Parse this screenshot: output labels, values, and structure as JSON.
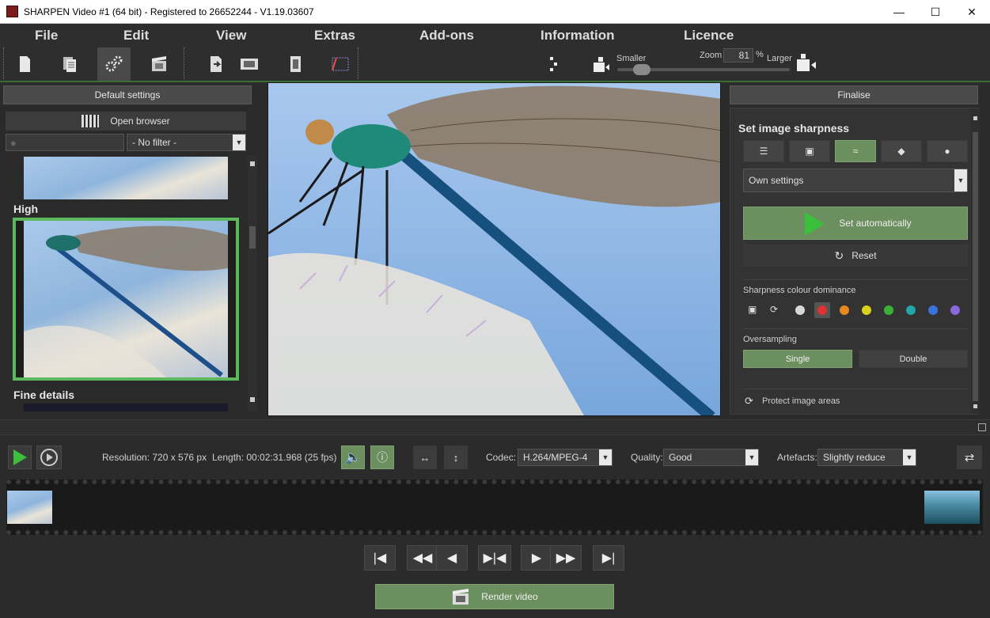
{
  "window": {
    "title": "SHARPEN Video #1 (64 bit) - Registered to 26652244 - V1.19.03607",
    "controls": [
      "minimize",
      "maximize",
      "close"
    ]
  },
  "menu": [
    "File",
    "Edit",
    "View",
    "Extras",
    "Add-ons",
    "Information",
    "Licence"
  ],
  "zoom": {
    "smaller_label": "Smaller",
    "zoom_label": "Zoom",
    "value": "81",
    "unit": "%",
    "larger_label": "Larger",
    "slider_level": 0.1
  },
  "left_panel": {
    "header": "Default settings",
    "open_browser": "Open browser",
    "search_placeholder": "",
    "filter": "- No filter -",
    "presets": [
      {
        "label": "High",
        "selected": true
      },
      {
        "label": "Fine details",
        "selected": false
      }
    ]
  },
  "right_panel": {
    "header": "Finalise",
    "section_title": "Set image sharpness",
    "mode_select": "Own settings",
    "set_auto": "Set automatically",
    "reset": "Reset",
    "colour_dominance_label": "Sharpness colour dominance",
    "colour_dots": [
      {
        "name": "white",
        "color": "#d8d8d8"
      },
      {
        "name": "red",
        "color": "#e03030",
        "selected": true
      },
      {
        "name": "orange",
        "color": "#e58a1e"
      },
      {
        "name": "yellow",
        "color": "#d8d21f"
      },
      {
        "name": "green",
        "color": "#3bb13b"
      },
      {
        "name": "teal",
        "color": "#22a6a6"
      },
      {
        "name": "blue",
        "color": "#3a74d8"
      },
      {
        "name": "purple",
        "color": "#8a6ad8"
      }
    ],
    "oversampling_label": "Oversampling",
    "oversampling_single": "Single",
    "oversampling_double": "Double",
    "protect_label": "Protect image areas"
  },
  "bottom_bar": {
    "resolution": "Resolution: 720 x 576 px",
    "length": "Length: 00:02:31.968 (25 fps)",
    "codec_label": "Codec:",
    "codec_value": "H.264/MPEG-4",
    "quality_label": "Quality:",
    "quality_value": "Good",
    "artefacts_label": "Artefacts:",
    "artefacts_value": "Slightly reduce"
  },
  "render": {
    "label": "Render video"
  },
  "colors": {
    "accent_green": "#3f6b35",
    "button_green": "#6b8f5e",
    "selection_border": "#5cb85c"
  }
}
